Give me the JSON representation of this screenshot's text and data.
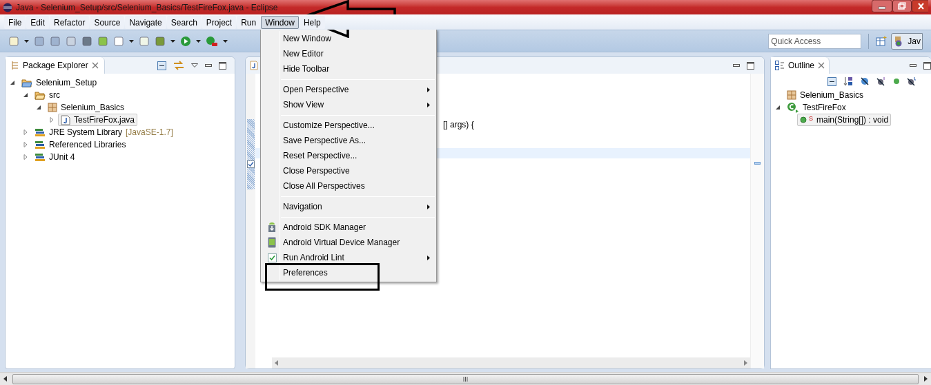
{
  "window": {
    "title": "Java - Selenium_Setup/src/Selenium_Basics/TestFireFox.java - Eclipse"
  },
  "menubar": [
    {
      "label": "File",
      "selected": false
    },
    {
      "label": "Edit",
      "selected": false
    },
    {
      "label": "Refactor",
      "selected": false
    },
    {
      "label": "Source",
      "selected": false
    },
    {
      "label": "Navigate",
      "selected": false
    },
    {
      "label": "Search",
      "selected": false
    },
    {
      "label": "Project",
      "selected": false
    },
    {
      "label": "Run",
      "selected": false
    },
    {
      "label": "Window",
      "selected": true
    },
    {
      "label": "Help",
      "selected": false
    }
  ],
  "toolbar": {
    "quick_access": {
      "placeholder": "Quick Access"
    },
    "perspective": {
      "label": "Jav",
      "selected": true
    }
  },
  "package_explorer": {
    "title": "Package Explorer",
    "tree": [
      {
        "label": "Selenium_Setup",
        "kind": "project",
        "expanded": true,
        "selected": false,
        "children": [
          {
            "label": "src",
            "kind": "folder",
            "expanded": true,
            "selected": false,
            "children": [
              {
                "label": "Selenium_Basics",
                "kind": "package",
                "expanded": true,
                "selected": false,
                "children": [
                  {
                    "label": "TestFireFox.java",
                    "kind": "file",
                    "expanded": false,
                    "selected": true
                  }
                ]
              }
            ]
          },
          {
            "label": "JRE System Library",
            "decoration": "[JavaSE-1.7]",
            "kind": "library",
            "expanded": false,
            "selected": false
          },
          {
            "label": "Referenced Libraries",
            "kind": "library",
            "expanded": false,
            "selected": false
          },
          {
            "label": "JUnit 4",
            "kind": "library",
            "expanded": false,
            "selected": false
          }
        ]
      }
    ]
  },
  "editor": {
    "code_lines": [
      "[] args) {"
    ]
  },
  "outline": {
    "title": "Outline",
    "tree": [
      {
        "label": "Selenium_Basics",
        "kind": "package",
        "selected": false
      },
      {
        "label": "TestFireFox",
        "kind": "class",
        "expanded": true,
        "selected": false,
        "children": [
          {
            "label": "main(String[]) : void",
            "badge": "S",
            "kind": "method",
            "selected": true
          }
        ]
      }
    ]
  },
  "window_menu": [
    {
      "kind": "item",
      "label": "New Window",
      "submenu": false
    },
    {
      "kind": "item",
      "label": "New Editor",
      "submenu": false
    },
    {
      "kind": "item",
      "label": "Hide Toolbar",
      "submenu": false
    },
    {
      "kind": "separator"
    },
    {
      "kind": "item",
      "label": "Open Perspective",
      "submenu": true
    },
    {
      "kind": "item",
      "label": "Show View",
      "submenu": true
    },
    {
      "kind": "separator"
    },
    {
      "kind": "item",
      "label": "Customize Perspective...",
      "submenu": false
    },
    {
      "kind": "item",
      "label": "Save Perspective As...",
      "submenu": false
    },
    {
      "kind": "item",
      "label": "Reset Perspective...",
      "submenu": false
    },
    {
      "kind": "item",
      "label": "Close Perspective",
      "submenu": false
    },
    {
      "kind": "item",
      "label": "Close All Perspectives",
      "submenu": false
    },
    {
      "kind": "separator"
    },
    {
      "kind": "item",
      "label": "Navigation",
      "submenu": true
    },
    {
      "kind": "separator"
    },
    {
      "kind": "sdk",
      "label": "Android SDK Manager",
      "submenu": false
    },
    {
      "kind": "avd",
      "label": "Android Virtual Device Manager",
      "submenu": false
    },
    {
      "kind": "lint",
      "label": "Run Android Lint",
      "submenu": true
    },
    {
      "kind": "item",
      "label": "Preferences",
      "submenu": false
    }
  ]
}
